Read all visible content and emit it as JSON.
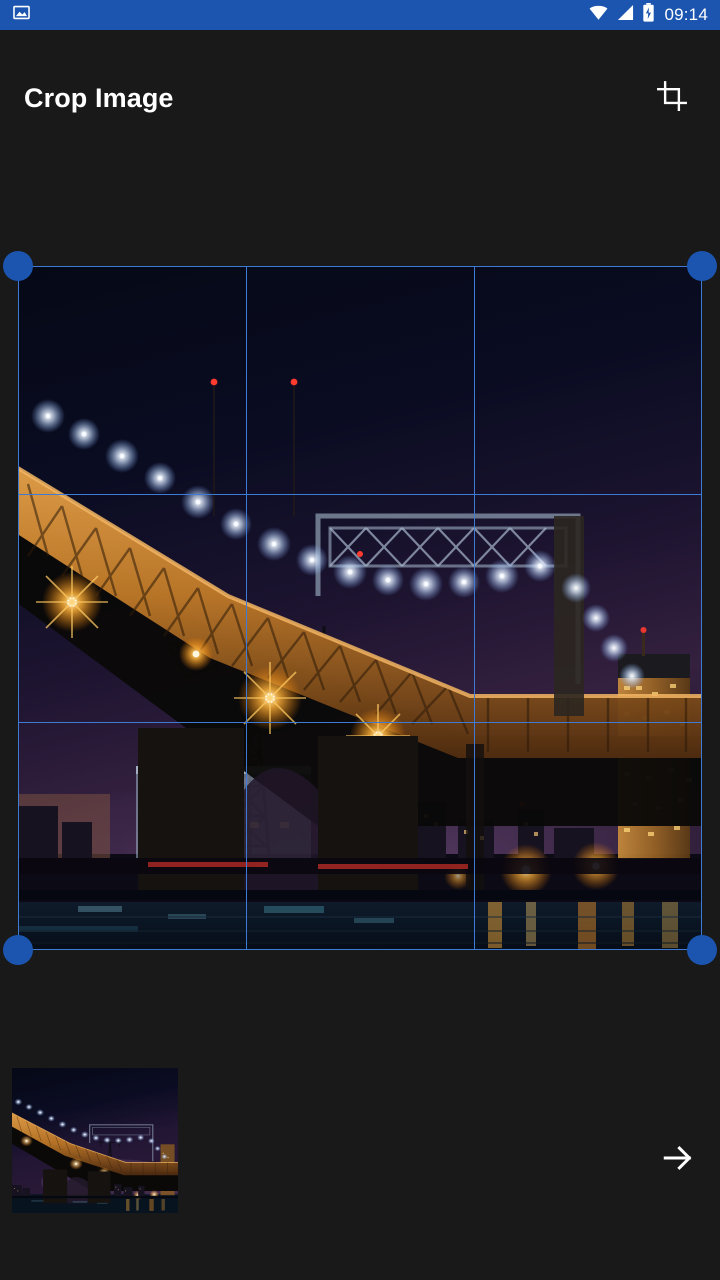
{
  "status_bar": {
    "background_color": "#1B55AF",
    "time": "09:14",
    "icons": {
      "notification": "gallery-image-icon",
      "wifi": "wifi-icon",
      "signal": "cell-signal-icon",
      "battery": "battery-charging-icon"
    }
  },
  "app_bar": {
    "title": "Crop Image",
    "action_icon": "crop-icon",
    "background_color": "#191919",
    "title_color": "#FFFFFF"
  },
  "crop_editor": {
    "accent_color": "#1B55AF",
    "grid_line_color": "#3E7BD6",
    "grid_rows": 3,
    "grid_columns": 3,
    "handles": [
      "top-left-handle",
      "top-right-handle",
      "bottom-left-handle",
      "bottom-right-handle"
    ],
    "image_description": "Night photo of an illuminated steel truss bridge over water with a city skyline"
  },
  "thumbnail_strip": {
    "thumbnail_label": "source-image-thumbnail",
    "next_icon": "arrow-right-icon"
  },
  "palette": {
    "page_background": "#191919",
    "accent_blue": "#1B55AF",
    "line_blue": "#3E7BD6",
    "sky_top": "#060a1c",
    "sky_mid": "#2a1733",
    "bridge_amber": "#d98326",
    "water": "#0b1626"
  }
}
